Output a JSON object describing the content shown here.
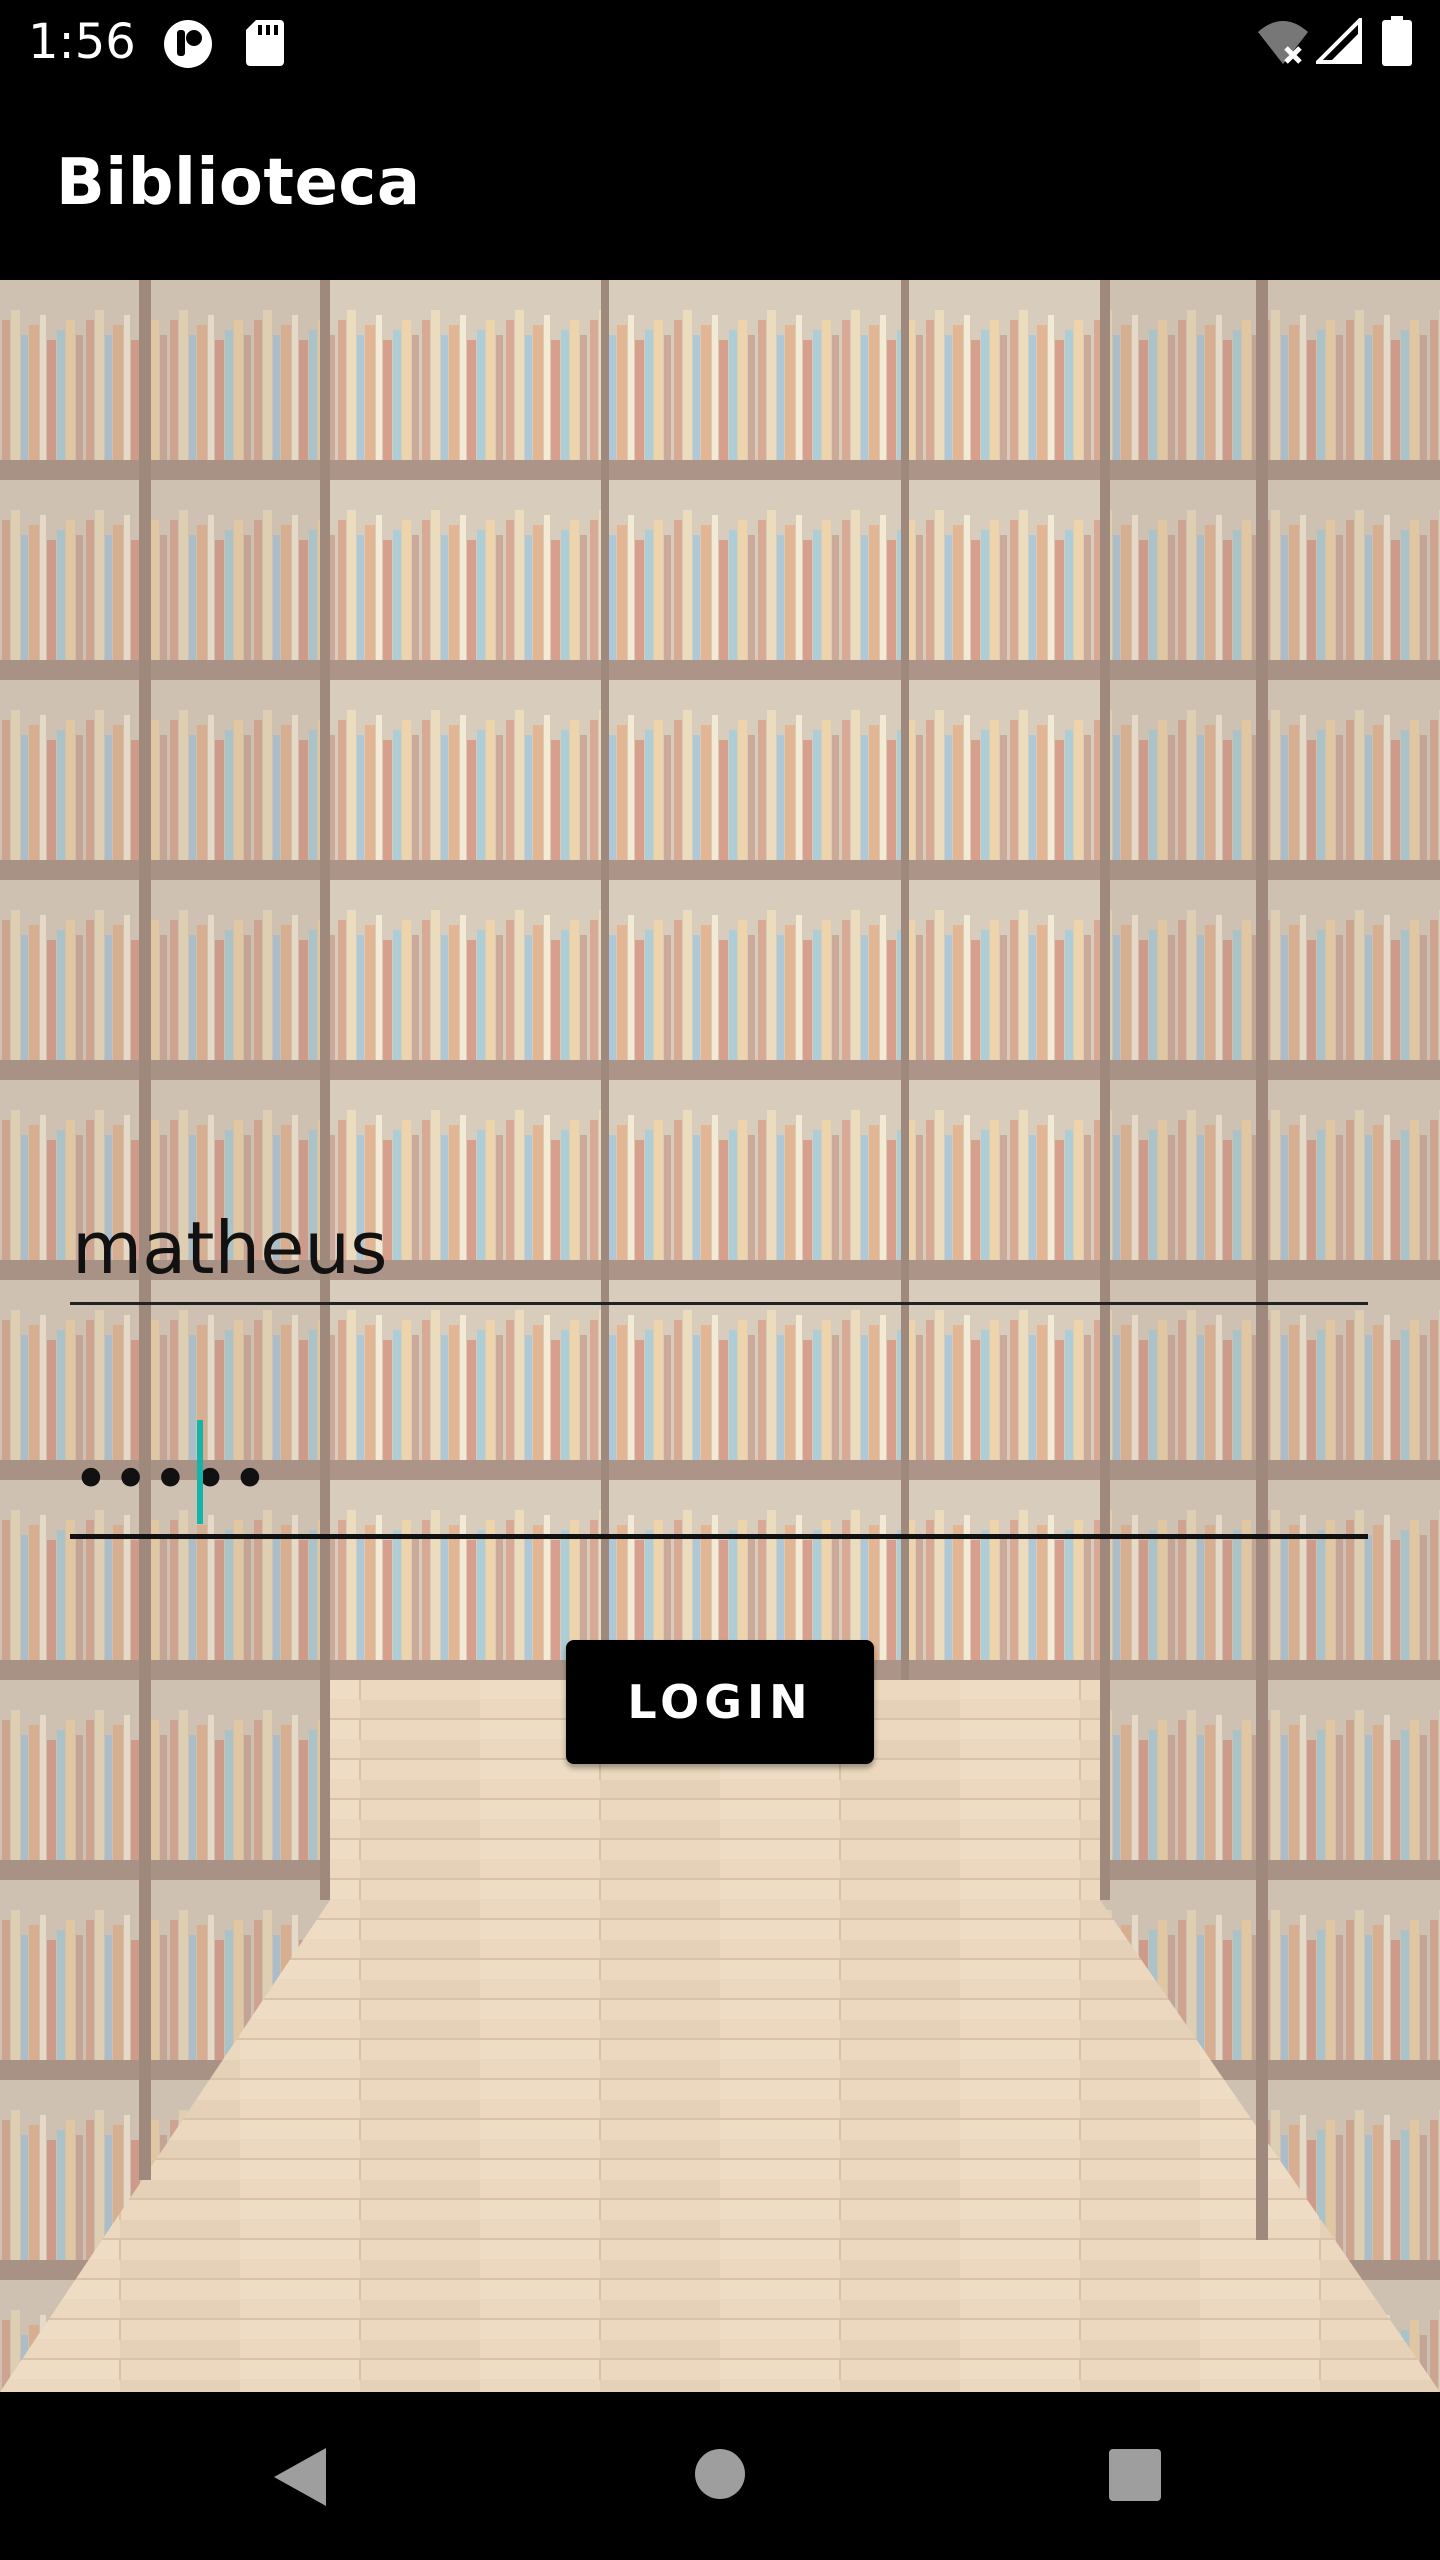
{
  "status_bar": {
    "time": "1:56",
    "icons": [
      "notification-icon",
      "sd-card-icon",
      "wifi-off-icon",
      "cellular-signal-icon",
      "battery-icon"
    ]
  },
  "app_bar": {
    "title": "Biblioteca"
  },
  "login_form": {
    "username_value": "matheus",
    "password_mask": "•••••",
    "login_button_label": "LOGIN",
    "accent_color": "#12b5a8"
  },
  "nav_bar": {
    "icons": [
      "back-icon",
      "home-icon",
      "recents-icon"
    ]
  }
}
